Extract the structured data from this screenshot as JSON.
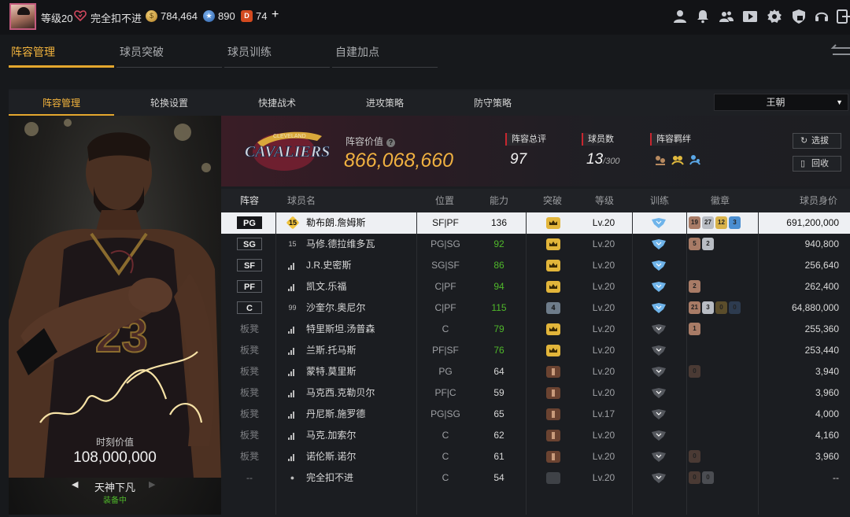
{
  "topbar": {
    "level": "等级20",
    "status": "完全扣不进",
    "coins": "784,464",
    "points": "890",
    "tickets": "74",
    "plus": "+"
  },
  "main_tabs": [
    "阵容管理",
    "球员突破",
    "球员训练",
    "自建加点"
  ],
  "sub_tabs": [
    "阵容管理",
    "轮换设置",
    "快捷战术",
    "进攻策略",
    "防守策略"
  ],
  "team_select": "王朝",
  "card": {
    "value_label": "时刻价值",
    "value": "108,000,000",
    "name": "天神下凡",
    "status": "装备中",
    "jersey": "23"
  },
  "team": {
    "logo_text": "CAVALIERS",
    "logo_sub": "CLEVELAND",
    "value_label": "阵容价值",
    "value": "866,068,660",
    "rating_label": "阵容总评",
    "rating": "97",
    "count_label": "球员数",
    "count": "13",
    "count_max": "/300",
    "chem_label": "阵容羁绊",
    "btn_pick": "选拔",
    "btn_recycle": "回收"
  },
  "columns": [
    "阵容",
    "球员名",
    "位置",
    "能力",
    "突破",
    "等级",
    "训练",
    "徽章",
    "球员身价"
  ],
  "players": [
    {
      "slot": "PG",
      "num": "15",
      "num_style": "gold",
      "name": "勒布朗.詹姆斯",
      "pos": "SF|PF",
      "ovr": "136",
      "ovr_green": false,
      "bt": "gold",
      "bt_num": "",
      "lv": "Lv.20",
      "train": "blue",
      "badges": [
        {
          "t": "19",
          "c": "#a87b66"
        },
        {
          "t": "27",
          "c": "#b9bdc4"
        },
        {
          "t": "12",
          "c": "#d8b24a"
        },
        {
          "t": "3",
          "c": "#4a8ed1"
        }
      ],
      "price": "691,200,000",
      "selected": true
    },
    {
      "slot": "SG",
      "num": "15",
      "num_style": "plain",
      "name": "马修.德拉维多瓦",
      "pos": "PG|SG",
      "ovr": "92",
      "ovr_green": true,
      "bt": "gold",
      "bt_num": "",
      "lv": "Lv.20",
      "train": "blue",
      "badges": [
        {
          "t": "5",
          "c": "#a87b66"
        },
        {
          "t": "2",
          "c": "#b9bdc4"
        }
      ],
      "price": "940,800",
      "selected": false
    },
    {
      "slot": "SF",
      "num": "",
      "num_style": "bars",
      "name": "J.R.史密斯",
      "pos": "SG|SF",
      "ovr": "86",
      "ovr_green": true,
      "bt": "gold",
      "bt_num": "",
      "lv": "Lv.20",
      "train": "blue",
      "badges": [],
      "price": "256,640",
      "selected": false
    },
    {
      "slot": "PF",
      "num": "",
      "num_style": "bars",
      "name": "凯文.乐福",
      "pos": "C|PF",
      "ovr": "94",
      "ovr_green": true,
      "bt": "gold",
      "bt_num": "",
      "lv": "Lv.20",
      "train": "blue",
      "badges": [
        {
          "t": "2",
          "c": "#a87b66"
        }
      ],
      "price": "262,400",
      "selected": false
    },
    {
      "slot": "C",
      "num": "99",
      "num_style": "plain",
      "name": "沙奎尔.奥尼尔",
      "pos": "C|PF",
      "ovr": "115",
      "ovr_green": true,
      "bt": "num",
      "bt_num": "4",
      "lv": "Lv.20",
      "train": "blue",
      "badges": [
        {
          "t": "21",
          "c": "#a87b66"
        },
        {
          "t": "3",
          "c": "#b9bdc4"
        },
        {
          "t": "0",
          "c": "#5b4d2b"
        },
        {
          "t": "0",
          "c": "#2d3b4f"
        }
      ],
      "price": "64,880,000",
      "selected": false
    },
    {
      "slot": "板凳",
      "num": "",
      "num_style": "bars",
      "name": "特里斯坦.汤普森",
      "pos": "C",
      "ovr": "79",
      "ovr_green": true,
      "bt": "gold",
      "bt_num": "",
      "lv": "Lv.20",
      "train": "grey",
      "badges": [
        {
          "t": "1",
          "c": "#a87b66"
        }
      ],
      "price": "255,360",
      "selected": false
    },
    {
      "slot": "板凳",
      "num": "",
      "num_style": "bars",
      "name": "兰斯.托马斯",
      "pos": "PF|SF",
      "ovr": "76",
      "ovr_green": true,
      "bt": "gold",
      "bt_num": "",
      "lv": "Lv.20",
      "train": "grey",
      "badges": [],
      "price": "253,440",
      "selected": false
    },
    {
      "slot": "板凳",
      "num": "",
      "num_style": "bars",
      "name": "蒙特.莫里斯",
      "pos": "PG",
      "ovr": "64",
      "ovr_green": false,
      "bt": "brown",
      "bt_num": "",
      "lv": "Lv.20",
      "train": "grey",
      "badges": [
        {
          "t": "0",
          "c": "#4a3a34"
        }
      ],
      "price": "3,940",
      "selected": false
    },
    {
      "slot": "板凳",
      "num": "",
      "num_style": "bars",
      "name": "马克西.克勒贝尔",
      "pos": "PF|C",
      "ovr": "59",
      "ovr_green": false,
      "bt": "brown",
      "bt_num": "",
      "lv": "Lv.20",
      "train": "grey",
      "badges": [],
      "price": "3,960",
      "selected": false
    },
    {
      "slot": "板凳",
      "num": "",
      "num_style": "bars",
      "name": "丹尼斯.施罗德",
      "pos": "PG|SG",
      "ovr": "65",
      "ovr_green": false,
      "bt": "brown",
      "bt_num": "",
      "lv": "Lv.17",
      "train": "grey",
      "badges": [],
      "price": "4,000",
      "selected": false
    },
    {
      "slot": "板凳",
      "num": "",
      "num_style": "bars",
      "name": "马克.加索尔",
      "pos": "C",
      "ovr": "62",
      "ovr_green": false,
      "bt": "brown",
      "bt_num": "",
      "lv": "Lv.20",
      "train": "grey",
      "badges": [],
      "price": "4,160",
      "selected": false
    },
    {
      "slot": "板凳",
      "num": "",
      "num_style": "bars",
      "name": "诺伦斯.诺尔",
      "pos": "C",
      "ovr": "61",
      "ovr_green": false,
      "bt": "brown",
      "bt_num": "",
      "lv": "Lv.20",
      "train": "grey",
      "badges": [
        {
          "t": "0",
          "c": "#4a3a34"
        }
      ],
      "price": "3,960",
      "selected": false
    },
    {
      "slot": "--",
      "num": "",
      "num_style": "person",
      "name": "完全扣不进",
      "pos": "C",
      "ovr": "54",
      "ovr_green": false,
      "bt": "grey",
      "bt_num": "",
      "lv": "Lv.20",
      "train": "grey",
      "badges": [
        {
          "t": "0",
          "c": "#4a3a34"
        },
        {
          "t": "0",
          "c": "#4b4d52"
        }
      ],
      "price": "--",
      "selected": false
    }
  ],
  "colors": {
    "accent": "#e4a72e",
    "value": "#f0b141",
    "green": "#4fb82a",
    "red_marker": "#c8262f"
  }
}
